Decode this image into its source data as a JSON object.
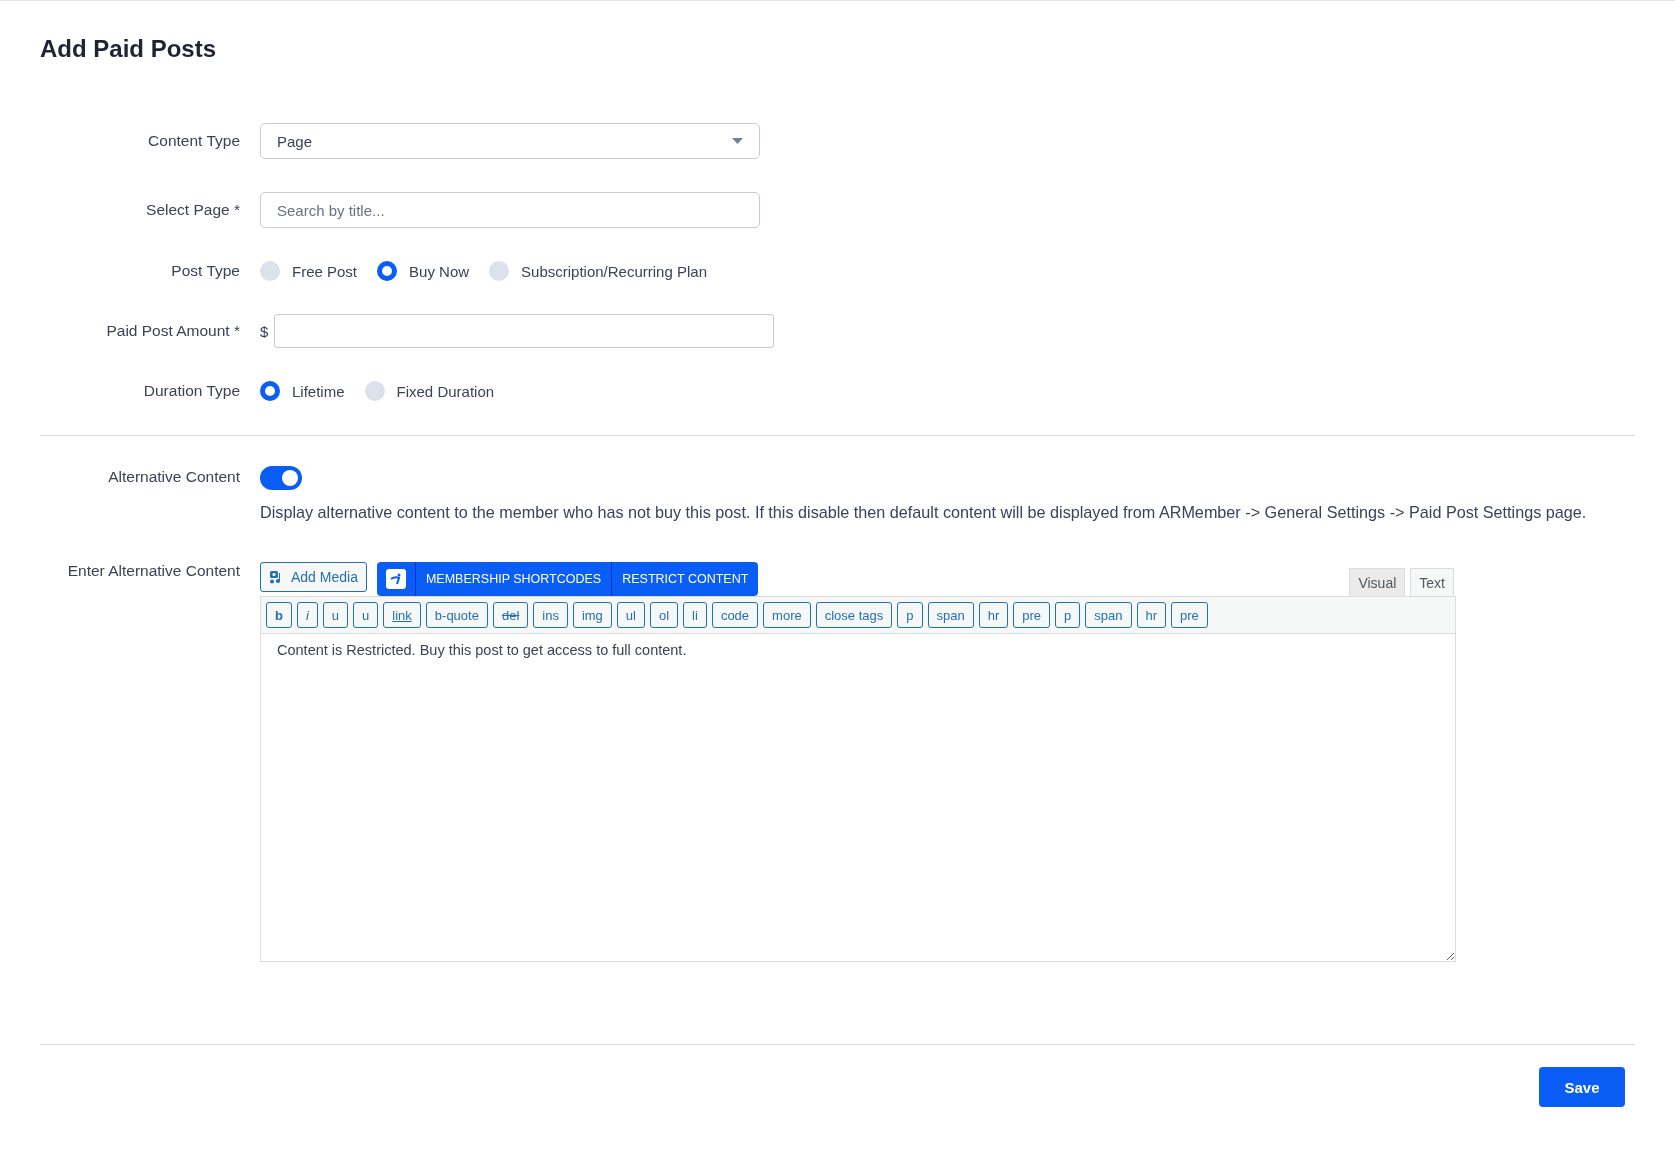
{
  "title": "Add Paid Posts",
  "content_type": {
    "label": "Content Type",
    "value": "Page"
  },
  "select_page": {
    "label": "Select Page *",
    "placeholder": "Search by title..."
  },
  "post_type": {
    "label": "Post Type",
    "options": [
      {
        "label": "Free Post",
        "selected": false
      },
      {
        "label": "Buy Now",
        "selected": true
      },
      {
        "label": "Subscription/Recurring Plan",
        "selected": false
      }
    ]
  },
  "amount": {
    "label": "Paid Post Amount *",
    "currency": "$"
  },
  "duration_type": {
    "label": "Duration Type",
    "options": [
      {
        "label": "Lifetime",
        "selected": true
      },
      {
        "label": "Fixed Duration",
        "selected": false
      }
    ]
  },
  "alternative_content": {
    "label": "Alternative Content",
    "on": true,
    "description": "Display alternative content to the member who has not buy this post. If this disable then default content will be displayed from ARMember -> General Settings -> Paid Post Settings page."
  },
  "editor": {
    "label": "Enter Alternative Content",
    "add_media": "Add Media",
    "shortcodes": "MEMBERSHIP SHORTCODES",
    "restrict": "RESTRICT CONTENT",
    "tabs": [
      {
        "label": "Visual",
        "selected": false
      },
      {
        "label": "Text",
        "selected": true
      }
    ],
    "quicktags": [
      {
        "label": "b",
        "kind": "bold"
      },
      {
        "label": "i",
        "kind": "italic"
      },
      {
        "label": "u",
        "kind": "plain"
      },
      {
        "label": "u",
        "kind": "plain"
      },
      {
        "label": "link",
        "kind": "underline"
      },
      {
        "label": "b-quote",
        "kind": "plain"
      },
      {
        "label": "del",
        "kind": "strike"
      },
      {
        "label": "ins",
        "kind": "plain"
      },
      {
        "label": "img",
        "kind": "plain"
      },
      {
        "label": "ul",
        "kind": "plain"
      },
      {
        "label": "ol",
        "kind": "plain"
      },
      {
        "label": "li",
        "kind": "plain"
      },
      {
        "label": "code",
        "kind": "plain"
      },
      {
        "label": "more",
        "kind": "plain"
      },
      {
        "label": "close tags",
        "kind": "plain"
      },
      {
        "label": "p",
        "kind": "plain"
      },
      {
        "label": "span",
        "kind": "plain"
      },
      {
        "label": "hr",
        "kind": "plain"
      },
      {
        "label": "pre",
        "kind": "plain"
      },
      {
        "label": "p",
        "kind": "plain"
      },
      {
        "label": "span",
        "kind": "plain"
      },
      {
        "label": "hr",
        "kind": "plain"
      },
      {
        "label": "pre",
        "kind": "plain"
      }
    ],
    "value": "Content is Restricted. Buy this post to get access to full content."
  },
  "save": "Save"
}
